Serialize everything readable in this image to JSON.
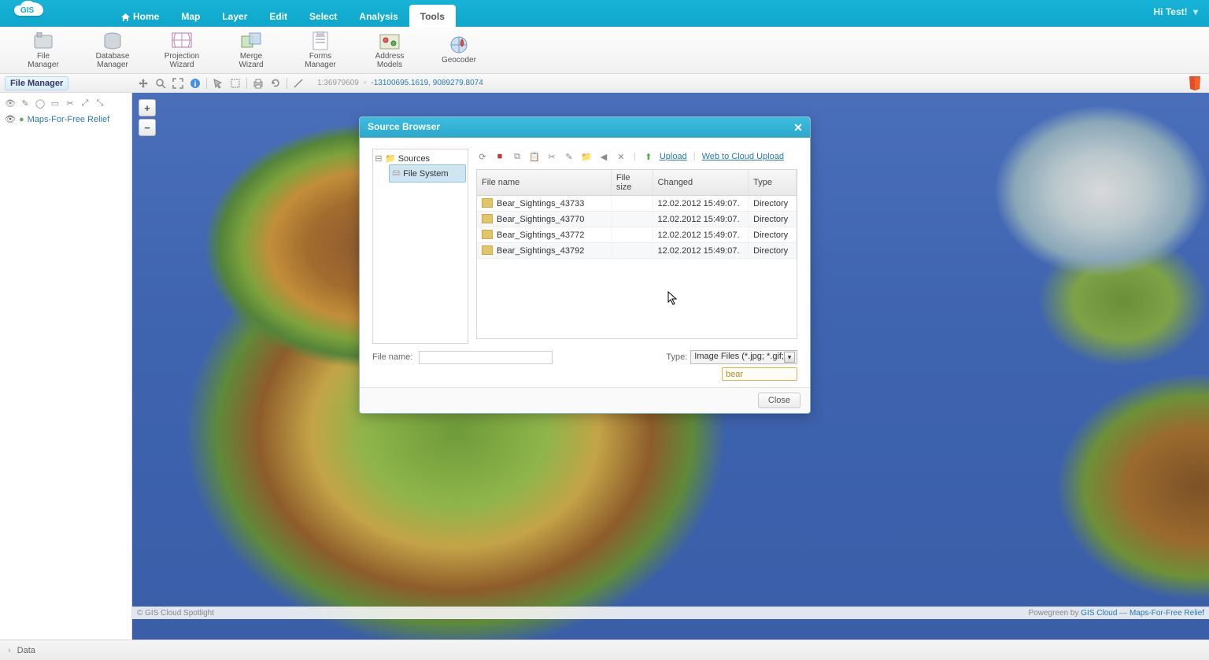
{
  "app": {
    "logo_text": "GIS"
  },
  "user": {
    "greeting": "Hi Test!"
  },
  "nav": {
    "tabs": [
      {
        "label": "Home"
      },
      {
        "label": "Map"
      },
      {
        "label": "Layer"
      },
      {
        "label": "Edit"
      },
      {
        "label": "Select"
      },
      {
        "label": "Analysis"
      },
      {
        "label": "Tools"
      }
    ],
    "active_index": 6
  },
  "ribbon": [
    {
      "label": "File\nManager"
    },
    {
      "label": "Database\nManager"
    },
    {
      "label": "Projection\nWizard"
    },
    {
      "label": "Merge\nWizard"
    },
    {
      "label": "Forms\nManager"
    },
    {
      "label": "Address\nModels"
    },
    {
      "label": "Geocoder"
    }
  ],
  "panel_title": "File Manager",
  "toolbar_coords": {
    "scale": "1:36979609",
    "xy": "-13100695.1619, 9089279.8074"
  },
  "layers": [
    {
      "name": "Maps-For-Free Relief"
    }
  ],
  "dialog": {
    "title": "Source Browser",
    "tree": {
      "root": "Sources",
      "children": [
        {
          "label": "File System",
          "selected": true
        }
      ]
    },
    "toolbar_links": {
      "upload": "Upload",
      "web_upload": "Web to Cloud Upload"
    },
    "columns": {
      "name": "File name",
      "size": "File size",
      "changed": "Changed",
      "type": "Type"
    },
    "rows": [
      {
        "name": "Bear_Sightings_43733",
        "size": "",
        "changed": "12.02.2012 15:49:07.",
        "type": "Directory"
      },
      {
        "name": "Bear_Sightings_43770",
        "size": "",
        "changed": "12.02.2012 15:49:07.",
        "type": "Directory"
      },
      {
        "name": "Bear_Sightings_43772",
        "size": "",
        "changed": "12.02.2012 15:49:07.",
        "type": "Directory"
      },
      {
        "name": "Bear_Sightings_43792",
        "size": "",
        "changed": "12.02.2012 15:49:07.",
        "type": "Directory"
      }
    ],
    "filename_label": "File name:",
    "filename_value": "",
    "type_label": "Type:",
    "type_value": "Image Files (*.jpg; *.gif;",
    "search_value": "bear",
    "close_label": "Close"
  },
  "status": {
    "left": "© GIS Cloud Spotlight",
    "right_prefix": "Powegreen by ",
    "brand": "GIS Cloud",
    "sep": " — ",
    "attribution": "Maps-For-Free Relief"
  },
  "bottom_tab": "Data"
}
